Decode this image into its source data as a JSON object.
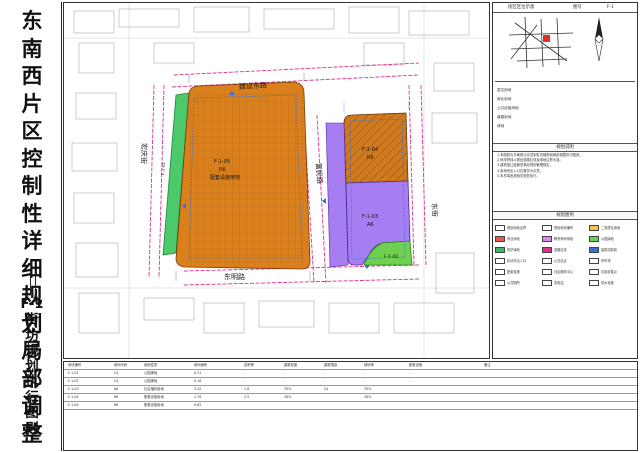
{
  "title_vertical": [
    "东",
    "南",
    "西",
    "片",
    "区",
    "控",
    "制",
    "性",
    "详",
    "细",
    "规",
    "划",
    "局",
    "部",
    "调",
    "整"
  ],
  "sheet_code": "F-1",
  "subtitle_vertical": [
    "街",
    "坊",
    "规",
    "划",
    "执",
    "行",
    "图",
    "则"
  ],
  "map": {
    "roads": {
      "north": "建设东路",
      "west": "宏庆街",
      "middle": "富民路",
      "south": "东明路",
      "east": "东街"
    },
    "parcels": [
      {
        "id": "F-1-05",
        "code": "R6",
        "note": "配套设施用地",
        "color": "#d9801c",
        "name": "F-1-05"
      },
      {
        "id": "F-1-04",
        "code": "R6",
        "color": "#d07a1f"
      },
      {
        "id": "F-1-03",
        "code": "A6",
        "color": "#a67ef2"
      },
      {
        "id": "F-1-02",
        "code": "G1",
        "color": "#6fd04f"
      },
      {
        "id": "F-1-01",
        "code": "G1",
        "color": "#4cc96b"
      }
    ]
  },
  "right_panel": {
    "header_left": "街区区位示意",
    "header_mid": "图号",
    "header_right": "F-1",
    "land_use_labels": [
      "居住用地",
      "商业用地",
      "公共设施用地",
      "道路用地",
      "绿地"
    ],
    "planning_notes_title": "规划说明",
    "notes_lines": [
      "1.本图则为东南西片区控制性详细规划局部调整执行图则。",
      "2.地块界线以规划道路红线及用地边界为准。",
      "3.建筑退让距离须满足规划管理规定。",
      "4.各地块出入口位置仅为示意。",
      "5.未尽事宜按相关规范执行。"
    ],
    "legend_title": "规划图例",
    "legend_items": [
      {
        "label": "规划用地边界",
        "color": "#ffffff"
      },
      {
        "label": "规划地块编号",
        "color": "#ffffff"
      },
      {
        "label": "二类居住用地",
        "color": "#f3c34d"
      },
      {
        "label": "商业用地",
        "color": "#e8594a"
      },
      {
        "label": "教育科研用地",
        "color": "#d98ae8"
      },
      {
        "label": "公园绿地",
        "color": "#6fd04f"
      },
      {
        "label": "防护绿地",
        "color": "#3fb56b"
      },
      {
        "label": "道路红线",
        "color": "#e0308a"
      },
      {
        "label": "建筑控制线",
        "color": "#3b6fd8"
      },
      {
        "label": "机动车出入口",
        "color": "#ffffff"
      },
      {
        "label": "公交站点",
        "color": "#ffffff"
      },
      {
        "label": "停车场",
        "color": "#ffffff"
      },
      {
        "label": "配套设施",
        "color": "#ffffff"
      },
      {
        "label": "社区服务中心",
        "color": "#ffffff"
      },
      {
        "label": "垃圾收集点",
        "color": "#ffffff"
      },
      {
        "label": "公共厕所",
        "color": "#ffffff"
      },
      {
        "label": "变电站",
        "color": "#ffffff"
      },
      {
        "label": "供水设施",
        "color": "#ffffff"
      }
    ]
  },
  "table": {
    "headers": [
      "地块编号",
      "用地代码",
      "用地性质",
      "用地面积",
      "容积率",
      "建筑密度",
      "建筑限高",
      "绿地率",
      "配套设施",
      "备注"
    ],
    "rows": [
      [
        "F-1-01",
        "G1",
        "公园绿地",
        "0.31",
        "-",
        "-",
        "-",
        "-",
        "-",
        ""
      ],
      [
        "F-1-02",
        "G1",
        "公园绿地",
        "0.16",
        "-",
        "-",
        "-",
        "-",
        "-",
        ""
      ],
      [
        "F-1-03",
        "A6",
        "社会福利用地",
        "3.42",
        "1.8",
        "35%",
        "24",
        "35%",
        "",
        ""
      ],
      [
        "F-1-04",
        "R6",
        "配套设施用地",
        "1.76",
        "2.5",
        "30%",
        "",
        "30%",
        "",
        ""
      ],
      [
        "F-1-05",
        "R6",
        "配套设施用地",
        "9.85",
        "",
        "",
        "",
        "",
        "",
        ""
      ]
    ]
  }
}
